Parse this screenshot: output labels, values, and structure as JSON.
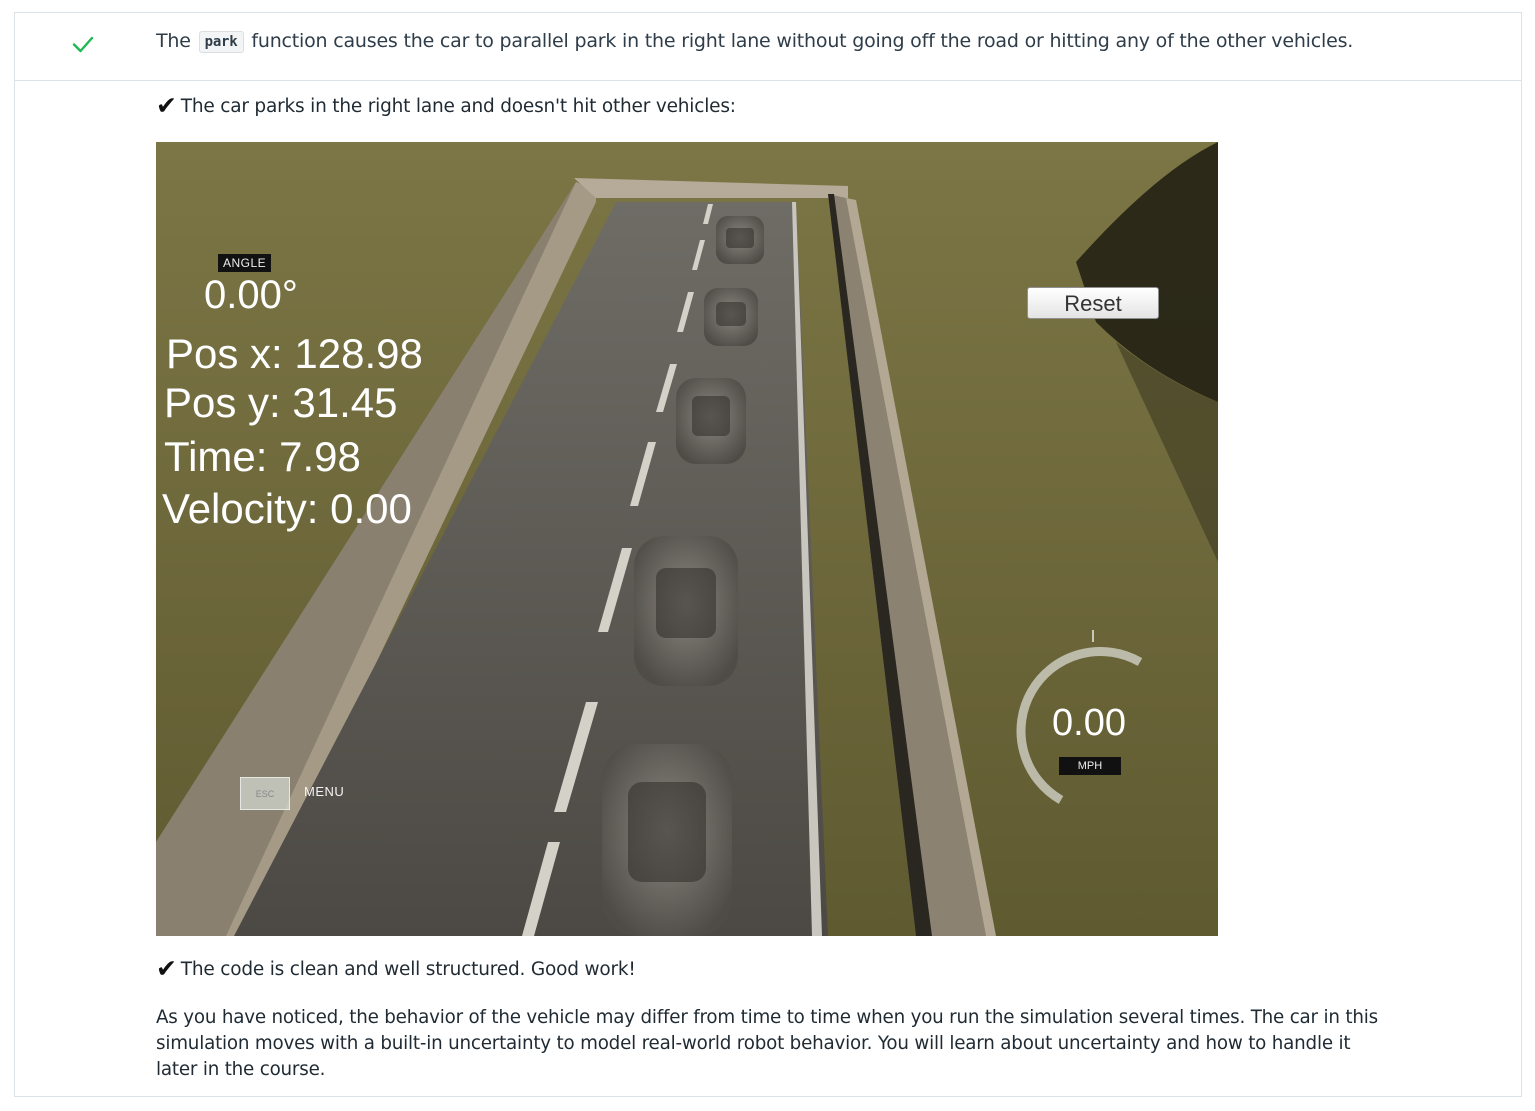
{
  "criterion": {
    "prefix": "The",
    "code": "park",
    "suffix": "function causes the car to parallel park in the right lane without going off the road or hitting any of the other vehicles."
  },
  "review": {
    "note1": "The car parks in the right lane and doesn't hit other vehicles:",
    "note2": "The code is clean and well structured. Good work!",
    "paragraph": "As you have noticed, the behavior of the vehicle may differ from time to time when you run the simulation several times. The car in this simulation moves with a built-in uncertainty to model real-world robot behavior. You will learn about uncertainty and how to handle it later in the course.",
    "tick": "✔"
  },
  "simulator": {
    "angle_label": "ANGLE",
    "angle_value": "0.00°",
    "pos_x": "Pos x: 128.98",
    "pos_y": "Pos y: 31.45",
    "time": "Time: 7.98",
    "velocity": "Velocity: 0.00",
    "reset_label": "Reset",
    "speed_value": "0.00",
    "speed_unit": "MPH",
    "esc_label": "ESC",
    "menu_label": "MENU"
  },
  "colors": {
    "accent_check": "#02b3e4",
    "check_green": "#1fb954",
    "grass": "#6f6a3a",
    "road": "#5a5650"
  }
}
